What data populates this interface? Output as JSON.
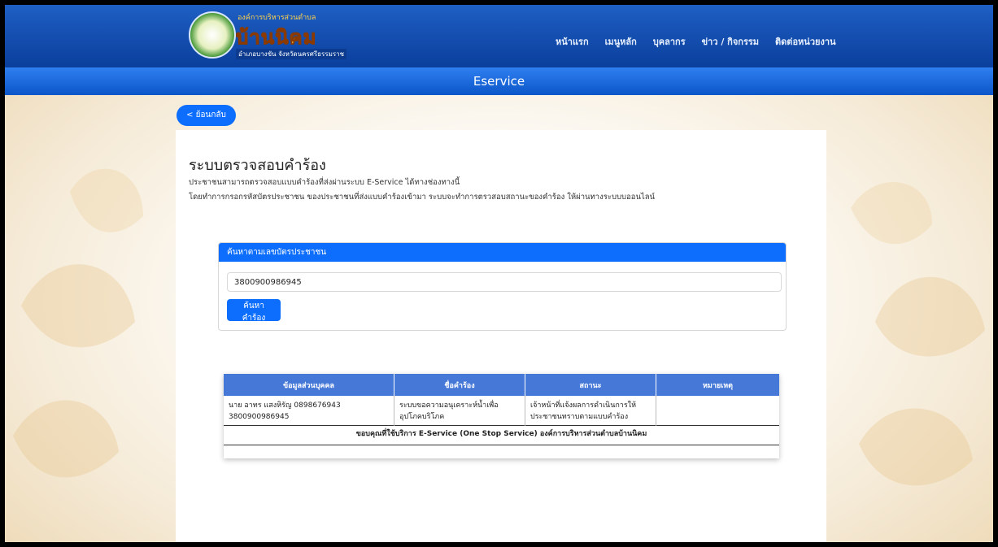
{
  "logo": {
    "top_text": "องค์การบริหารส่วนตำบล",
    "name": "บ้านนิคม",
    "sub_text": "อำเภอบางขัน จังหวัดนครศรีธรรมราช"
  },
  "nav": {
    "items": [
      "หน้าแรก",
      "เมนูหลัก",
      "บุคลากร",
      "ข่าว / กิจกรรม",
      "ติดต่อหน่วยงาน"
    ]
  },
  "banner": {
    "title": "Eservice"
  },
  "back_button": {
    "label": "< ย้อนกลับ"
  },
  "page": {
    "title": "ระบบตรวจสอบคำร้อง",
    "desc_line1": "ประชาชนสามารถตรวจสอบแบบคำร้องที่ส่งผ่านระบบ E-Service ได้ทางช่องทางนี้",
    "desc_line2": "โดยทำการกรอกรหัสบัตรประชาชน ของประชาชนที่ส่งแบบคำร้องเข้ามา ระบบจะทำการตรวสอบสถานะของคำร้อง ให้ผ่านทางระบบบออนไลน์"
  },
  "search": {
    "header": "ค้นหาตามเลขบัตรประชาชน",
    "value": "3800900986945",
    "button_label": "ค้นหาคำร้อง"
  },
  "results": {
    "headers": [
      "ข้อมูลส่วนบุคคล",
      "ชื่อคำร้อง",
      "สถานะ",
      "หมายเหตุ"
    ],
    "row": {
      "person_line1": "นาย อาทร แสงหิรัญ 0898676943",
      "person_line2": "3800900986945",
      "request_line1": "ระบบขอความอนุเคราะห์น้ำเพื่อ",
      "request_line2": "อุปโภคบริโภค",
      "status_line1": "เจ้าหน้าที่แจ้งผลการดำเนินการให้",
      "status_line2": "ประชาชนทราบตามแบบคำร้อง",
      "note": ""
    },
    "footer": "ขอบคุณที่ใช้บริการ E-Service (One Stop Service) องค์การบริหารส่วนตำบลบ้านนิคม"
  },
  "colors": {
    "primary": "#0d6efd",
    "topbar": "#0a3f9c",
    "table_header": "#4678d8"
  }
}
